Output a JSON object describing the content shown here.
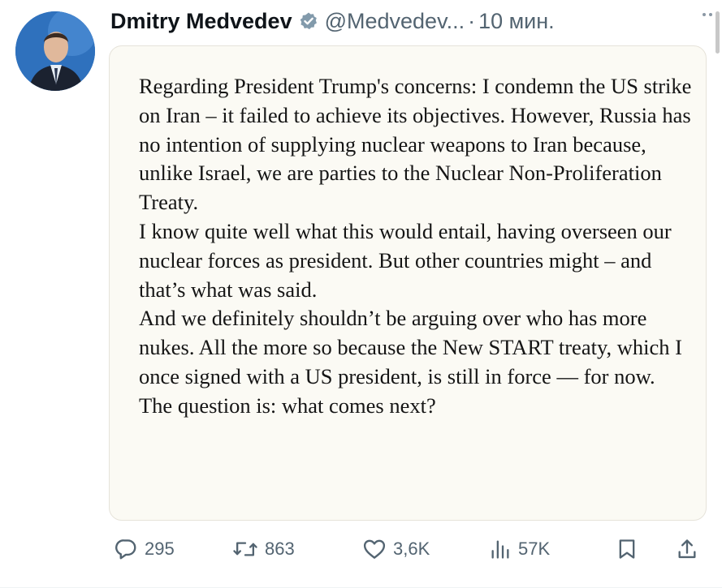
{
  "tweet": {
    "display_name": "Dmitry Medvedev",
    "handle": "@Medvedev...",
    "separator": "·",
    "time": "10 мин."
  },
  "quote_image": {
    "paragraphs": [
      "Regarding President Trump's concerns: I condemn the US strike on Iran – it failed to achieve its objectives. However, Russia has no intention of supplying nuclear weapons to Iran because, unlike Israel, we are parties to the Nuclear Non-Proliferation Treaty.",
      "I know quite well what this would entail, having overseen our nuclear forces as president. But other countries might – and that’s what was said.",
      "And we definitely shouldn’t be arguing over who has more nukes. All the more so because the New START treaty, which I once signed with a US president, is still in force — for now. The question is: what comes next?"
    ]
  },
  "actions": {
    "replies": "295",
    "reposts": "863",
    "likes": "3,6K",
    "views": "57K"
  },
  "icons": {
    "verified": "verified-badge-icon",
    "more": "more-icon",
    "reply": "reply-icon",
    "repost": "repost-icon",
    "like": "like-icon",
    "views": "views-icon",
    "bookmark": "bookmark-icon",
    "share": "share-icon"
  },
  "colors": {
    "text": "#0f1419",
    "muted": "#536471",
    "verified_gold": "#829aab",
    "quote_background": "#fbfaf4"
  }
}
